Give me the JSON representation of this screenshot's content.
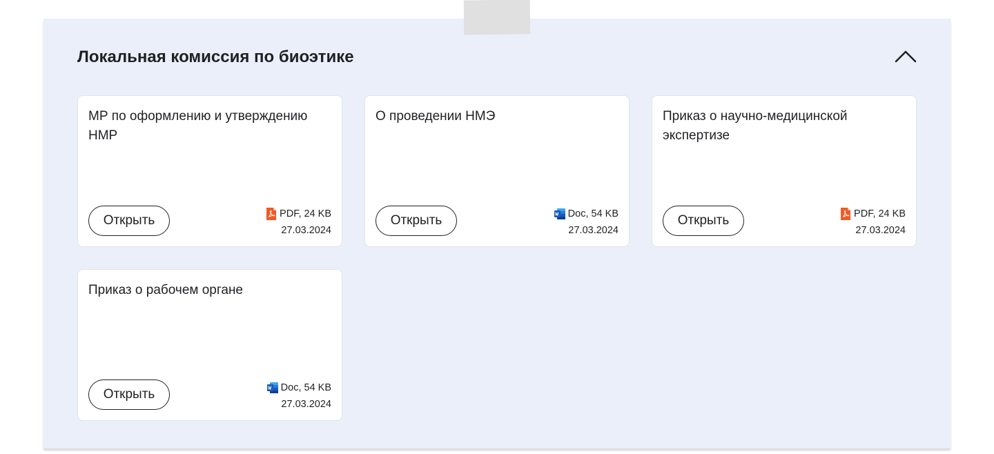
{
  "section": {
    "title": "Локальная комиссия по биоэтике",
    "collapse_icon": "chevron-up-icon"
  },
  "documents": [
    {
      "title": "МР по оформлению и утверждению НМР",
      "button_label": "Открыть",
      "file_type": "PDF, 24 KB",
      "date": "27.03.2024",
      "icon": "pdf-icon"
    },
    {
      "title": "О проведении НМЭ",
      "button_label": "Открыть",
      "file_type": "Doc, 54 KB",
      "date": "27.03.2024",
      "icon": "word-doc-icon"
    },
    {
      "title": "Приказ о научно-медицинской экспертизе",
      "button_label": "Открыть",
      "file_type": "PDF, 24 KB",
      "date": "27.03.2024",
      "icon": "pdf-icon"
    },
    {
      "title": "Приказ о рабочем органе",
      "button_label": "Открыть",
      "file_type": "Doc, 54 KB",
      "date": "27.03.2024",
      "icon": "word-doc-icon"
    }
  ],
  "colors": {
    "panel_bg": "#ebeffa",
    "pdf_icon": "#f15a24",
    "doc_icon": "#185abd"
  }
}
